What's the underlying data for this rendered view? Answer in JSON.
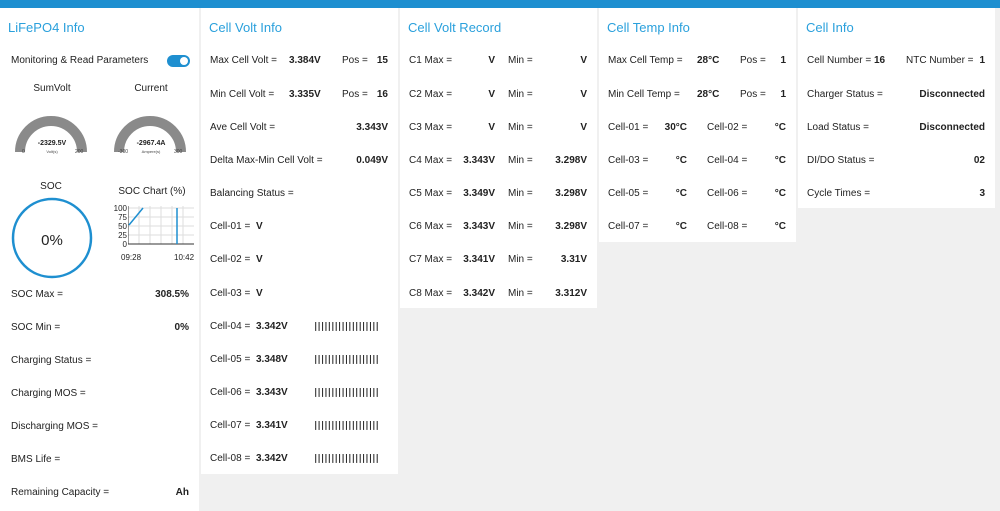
{
  "lifepo4": {
    "title": "LiFePO4 Info",
    "monitoring_label": "Monitoring & Read Parameters",
    "monitoring_on": true,
    "sumvolt": {
      "label": "SumVolt",
      "value": "-2329.5V",
      "unit": "Volt(s)",
      "min": "0",
      "max": "200",
      "level": 0
    },
    "current": {
      "label": "Current",
      "value": "-2967.4A",
      "unit": "Ampere(s)",
      "min": "-300",
      "max": "300",
      "level": 0
    },
    "soc": {
      "label": "SOC",
      "value": "0%"
    },
    "soc_chart": {
      "title": "SOC Chart (%)",
      "y_ticks": [
        "100",
        "75",
        "50",
        "25",
        "0"
      ],
      "x_ticks": [
        "09:28",
        "10:42"
      ]
    },
    "rows": [
      {
        "label": "SOC Max =",
        "value": "308.5%"
      },
      {
        "label": "SOC Min =",
        "value": "0%"
      },
      {
        "label": "Charging Status =",
        "value": ""
      },
      {
        "label": "Charging MOS =",
        "value": ""
      },
      {
        "label": "Discharging MOS =",
        "value": ""
      },
      {
        "label": "BMS Life =",
        "value": ""
      },
      {
        "label": "Remaining Capacity =",
        "value": "Ah"
      }
    ]
  },
  "cell_volt": {
    "title": "Cell Volt Info",
    "max": {
      "label": "Max Cell Volt =",
      "value": "3.384V",
      "pos_label": "Pos =",
      "pos": "15"
    },
    "min": {
      "label": "Min Cell Volt =",
      "value": "3.335V",
      "pos_label": "Pos =",
      "pos": "16"
    },
    "ave": {
      "label": "Ave Cell Volt =",
      "value": "3.343V"
    },
    "delta": {
      "label": "Delta Max-Min Cell Volt =",
      "value": "0.049V"
    },
    "balancing": {
      "label": "Balancing Status =",
      "value": ""
    },
    "cells": [
      {
        "label": "Cell-01 =",
        "value": "V",
        "bars": ""
      },
      {
        "label": "Cell-02 =",
        "value": "V",
        "bars": ""
      },
      {
        "label": "Cell-03 =",
        "value": "V",
        "bars": ""
      },
      {
        "label": "Cell-04 =",
        "value": "3.342V",
        "bars": "|||||||||||||||||||"
      },
      {
        "label": "Cell-05 =",
        "value": "3.348V",
        "bars": "|||||||||||||||||||"
      },
      {
        "label": "Cell-06 =",
        "value": "3.343V",
        "bars": "|||||||||||||||||||"
      },
      {
        "label": "Cell-07 =",
        "value": "3.341V",
        "bars": "|||||||||||||||||||"
      },
      {
        "label": "Cell-08 =",
        "value": "3.342V",
        "bars": "|||||||||||||||||||"
      }
    ]
  },
  "cell_record": {
    "title": "Cell Volt Record",
    "rows": [
      {
        "label": "C1 Max =",
        "max": "V",
        "min_label": "Min =",
        "min": "V"
      },
      {
        "label": "C2 Max =",
        "max": "V",
        "min_label": "Min =",
        "min": "V"
      },
      {
        "label": "C3 Max =",
        "max": "V",
        "min_label": "Min =",
        "min": "V"
      },
      {
        "label": "C4 Max =",
        "max": "3.343V",
        "min_label": "Min =",
        "min": "3.298V"
      },
      {
        "label": "C5 Max =",
        "max": "3.349V",
        "min_label": "Min =",
        "min": "3.298V"
      },
      {
        "label": "C6 Max =",
        "max": "3.343V",
        "min_label": "Min =",
        "min": "3.298V"
      },
      {
        "label": "C7 Max =",
        "max": "3.341V",
        "min_label": "Min =",
        "min": "3.31V"
      },
      {
        "label": "C8 Max =",
        "max": "3.342V",
        "min_label": "Min =",
        "min": "3.312V"
      }
    ]
  },
  "cell_temp": {
    "title": "Cell Temp Info",
    "max": {
      "label": "Max Cell Temp =",
      "value": "28°C",
      "pos_label": "Pos =",
      "pos": "1"
    },
    "min": {
      "label": "Min Cell Temp =",
      "value": "28°C",
      "pos_label": "Pos =",
      "pos": "1"
    },
    "cells": [
      {
        "a_label": "Cell-01 =",
        "a": "30°C",
        "b_label": "Cell-02 =",
        "b": "°C"
      },
      {
        "a_label": "Cell-03 =",
        "a": "°C",
        "b_label": "Cell-04 =",
        "b": "°C"
      },
      {
        "a_label": "Cell-05 =",
        "a": "°C",
        "b_label": "Cell-06 =",
        "b": "°C"
      },
      {
        "a_label": "Cell-07 =",
        "a": "°C",
        "b_label": "Cell-08 =",
        "b": "°C"
      }
    ]
  },
  "cell_info": {
    "title": "Cell Info",
    "cell_number": {
      "label": "Cell Number =",
      "value": "16"
    },
    "ntc_number": {
      "label": "NTC Number =",
      "value": "1"
    },
    "rows": [
      {
        "label": "Charger Status =",
        "value": "Disconnected"
      },
      {
        "label": "Load Status =",
        "value": "Disconnected"
      },
      {
        "label": "DI/DO Status =",
        "value": "02"
      },
      {
        "label": "Cycle Times =",
        "value": "3"
      }
    ]
  },
  "colors": {
    "accent": "#1e8fd0",
    "title": "#2aa0dc",
    "gauge_track": "#8a8a8a",
    "background": "#f0f0f0"
  }
}
